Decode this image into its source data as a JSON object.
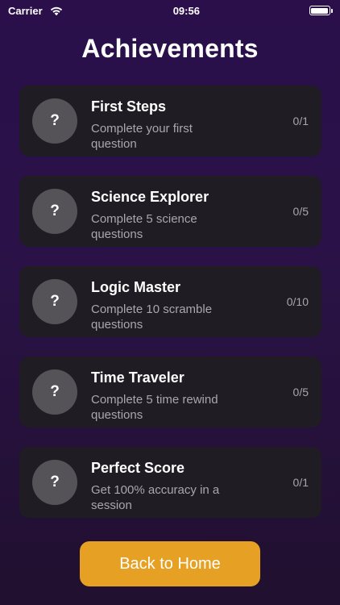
{
  "status_bar": {
    "carrier": "Carrier",
    "time": "09:56",
    "icons": [
      "wifi-icon",
      "battery-icon"
    ]
  },
  "page": {
    "title": "Achievements"
  },
  "achievements": [
    {
      "icon": "?",
      "title": "First Steps",
      "description": "Complete your first question",
      "progress": "0/1"
    },
    {
      "icon": "?",
      "title": "Science Explorer",
      "description": "Complete 5 science questions",
      "progress": "0/5"
    },
    {
      "icon": "?",
      "title": "Logic Master",
      "description": "Complete 10 scramble questions",
      "progress": "0/10"
    },
    {
      "icon": "?",
      "title": "Time Traveler",
      "description": "Complete 5 time rewind questions",
      "progress": "0/5"
    },
    {
      "icon": "?",
      "title": "Perfect Score",
      "description": "Get 100% accuracy in a session",
      "progress": "0/1"
    }
  ],
  "footer": {
    "button_label": "Back to Home"
  },
  "colors": {
    "background_top": "#2a0f4a",
    "background_bottom": "#21102f",
    "card": "#1f1c24",
    "icon_circle": "#555357",
    "secondary_text": "#a9a6ad",
    "button": "#e6a023"
  }
}
